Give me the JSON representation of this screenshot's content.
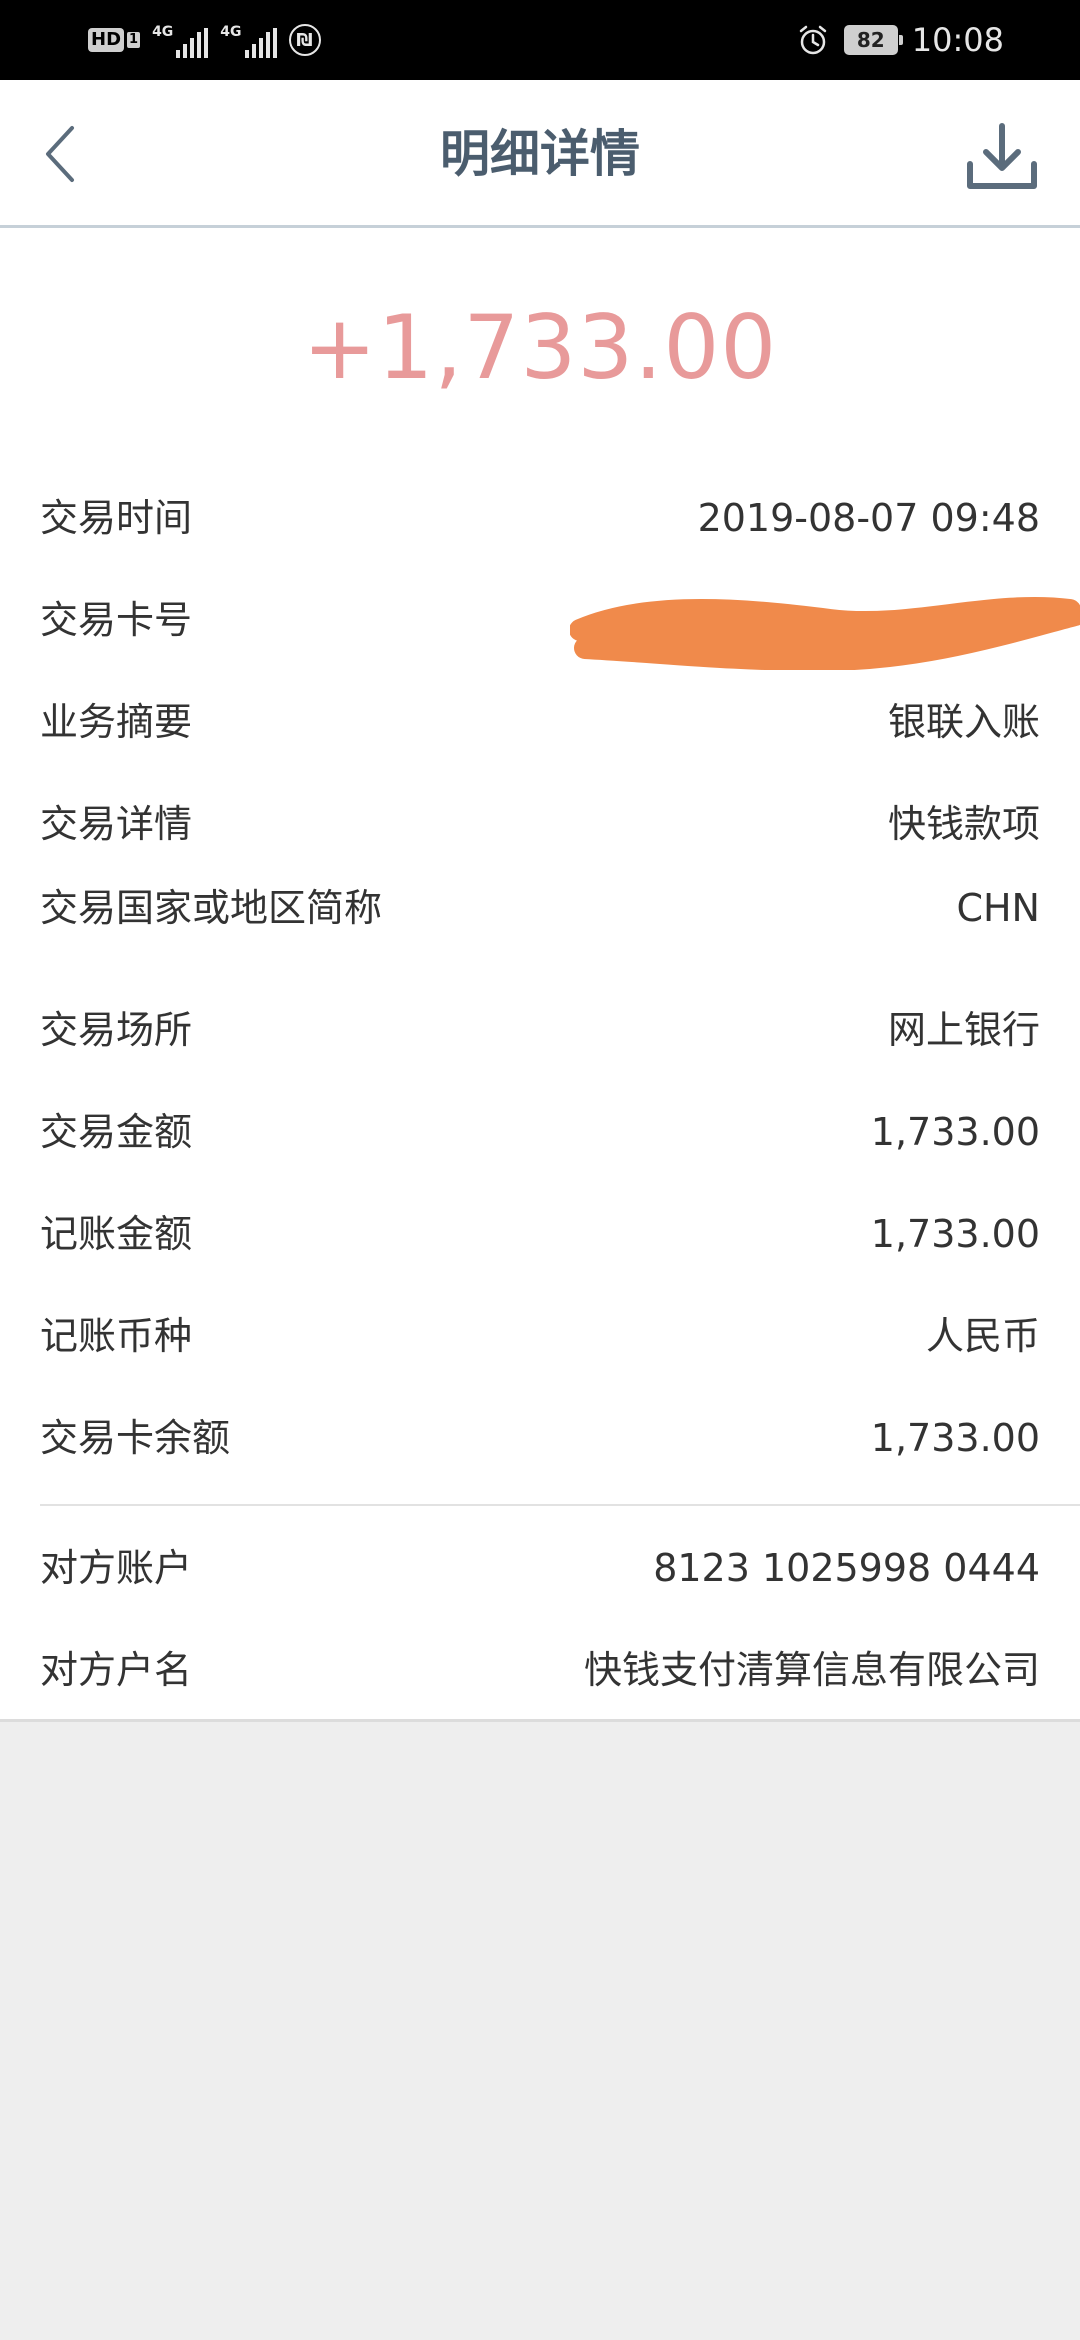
{
  "status_bar": {
    "hd_label": "HD",
    "hd_sim": "1",
    "network_1": "4G",
    "network_2": "4G",
    "coin_glyph": "₪",
    "battery": "82",
    "time": "10:08",
    "icons": [
      "hd-icon",
      "signal-icon",
      "signal-icon",
      "coin-icon",
      "alarm-icon",
      "battery-icon"
    ]
  },
  "nav": {
    "title": "明细详情",
    "back_icon": "chevron-left-icon",
    "download_icon": "download-icon"
  },
  "amount": "+1,733.00",
  "colors": {
    "amount": "#e89a9a",
    "title": "#4b5d6e",
    "redaction": "#f08a4b",
    "status_bar": "#000000",
    "background": "#eeeeee"
  },
  "details": [
    {
      "label": "交易时间",
      "value": "2019-08-07 09:48"
    },
    {
      "label": "交易卡号",
      "value": ""
    },
    {
      "label": "业务摘要",
      "value": "银联入账"
    },
    {
      "label": "交易详情",
      "value": "快钱款项"
    },
    {
      "label": "交易国家或地区简称",
      "value": "CHN"
    },
    {
      "label": "交易场所",
      "value": "网上银行"
    },
    {
      "label": "交易金额",
      "value": "1,733.00"
    },
    {
      "label": "记账金额",
      "value": "1,733.00"
    },
    {
      "label": "记账币种",
      "value": "人民币"
    },
    {
      "label": "交易卡余额",
      "value": "1,733.00"
    }
  ],
  "counterparty": [
    {
      "label": "对方账户",
      "value": "8123 1025998 0444"
    },
    {
      "label": "对方户名",
      "value": "快钱支付清算信息有限公司"
    }
  ]
}
